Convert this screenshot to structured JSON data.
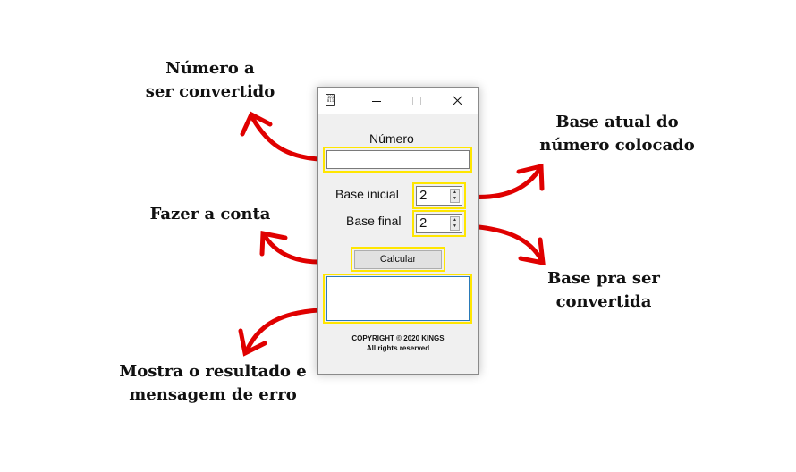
{
  "window": {
    "icon_text": "101\n011",
    "labels": {
      "numero": "Número",
      "base_inicial": "Base inicial",
      "base_final": "Base final"
    },
    "inputs": {
      "numero_value": "",
      "base_inicial_value": "2",
      "base_final_value": "2",
      "result_value": ""
    },
    "calcular_label": "Calcular",
    "copyright_line1": "COPYRIGHT © 2020 KINGS",
    "copyright_line2": "All rights reserved"
  },
  "annotations": {
    "numero": [
      "Número a",
      "ser convertido"
    ],
    "fazer_conta": [
      "Fazer a conta"
    ],
    "resultado": [
      "Mostra o resultado e",
      "mensagem de erro"
    ],
    "base_atual": [
      "Base atual do",
      "número colocado"
    ],
    "base_pra_ser": [
      "Base pra ser",
      "convertida"
    ]
  },
  "colors": {
    "highlight": "#ffe600",
    "arrow": "#e00000",
    "result_border": "#2a7ab8"
  }
}
